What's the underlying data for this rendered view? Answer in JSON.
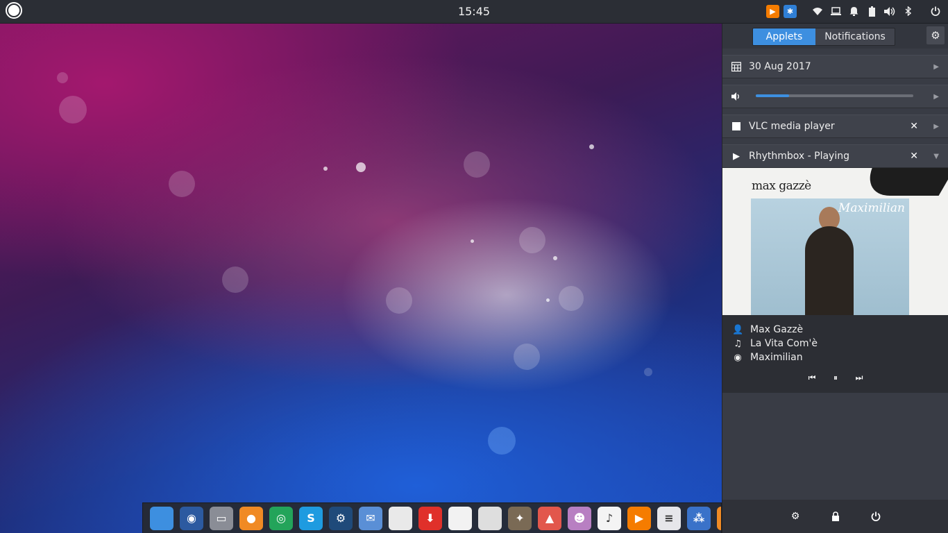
{
  "top_panel": {
    "clock": "15:45",
    "tray": {
      "vlc_color": "#f57c00",
      "bluetooth_app_color": "#2f7fd6",
      "icons": [
        "wifi-icon",
        "monitor-icon",
        "bell-icon",
        "battery-icon",
        "volume-icon",
        "bluetooth-icon",
        "power-icon"
      ]
    }
  },
  "sidebar": {
    "tabs": {
      "applets": "Applets",
      "notifications": "Notifications"
    },
    "calendar": {
      "date": "30 Aug 2017"
    },
    "volume": {
      "level": 0.21
    },
    "vlc": {
      "label": "VLC media player"
    },
    "rhythmbox": {
      "label": "Rhythmbox - Playing",
      "artist": "Max Gazzè",
      "title": "La Vita Com'è",
      "album": "Maximilian"
    },
    "album_art": {
      "artist_text": "max gazzè",
      "album_script": "Maximilian"
    }
  },
  "dock": {
    "apps": [
      {
        "name": "show-desktop",
        "color": "#3d8fe0",
        "glyph": ""
      },
      {
        "name": "screenshot",
        "color": "#2c5aa0",
        "glyph": "◉"
      },
      {
        "name": "files",
        "color": "#8a8d96",
        "glyph": "▭"
      },
      {
        "name": "firefox",
        "color": "#f08a24",
        "glyph": "●"
      },
      {
        "name": "chrome",
        "color": "#23a45a",
        "glyph": "◎"
      },
      {
        "name": "skype",
        "color": "#1e9be0",
        "glyph": "S"
      },
      {
        "name": "steam",
        "color": "#1f4a7a",
        "glyph": "⚙"
      },
      {
        "name": "mail",
        "color": "#5a8fd6",
        "glyph": "✉"
      },
      {
        "name": "calendar",
        "color": "#e9e9e9",
        "glyph": ""
      },
      {
        "name": "software",
        "color": "#e0302a",
        "glyph": "⬇"
      },
      {
        "name": "document",
        "color": "#f2f2f2",
        "glyph": ""
      },
      {
        "name": "text-editor",
        "color": "#dedede",
        "glyph": ""
      },
      {
        "name": "gimp",
        "color": "#7a6a55",
        "glyph": "✦"
      },
      {
        "name": "photos",
        "color": "#e2574c",
        "glyph": "▲"
      },
      {
        "name": "games",
        "color": "#b87fc2",
        "glyph": "☻"
      },
      {
        "name": "music",
        "color": "#f4f4f4",
        "glyph": "♪"
      },
      {
        "name": "vlc",
        "color": "#f57c00",
        "glyph": "▶"
      },
      {
        "name": "settings",
        "color": "#e6e6ea",
        "glyph": "≡"
      },
      {
        "name": "apps-grid",
        "color": "#3a72c9",
        "glyph": "⁂"
      },
      {
        "name": "extra",
        "color": "#f08a24",
        "glyph": ""
      }
    ]
  }
}
